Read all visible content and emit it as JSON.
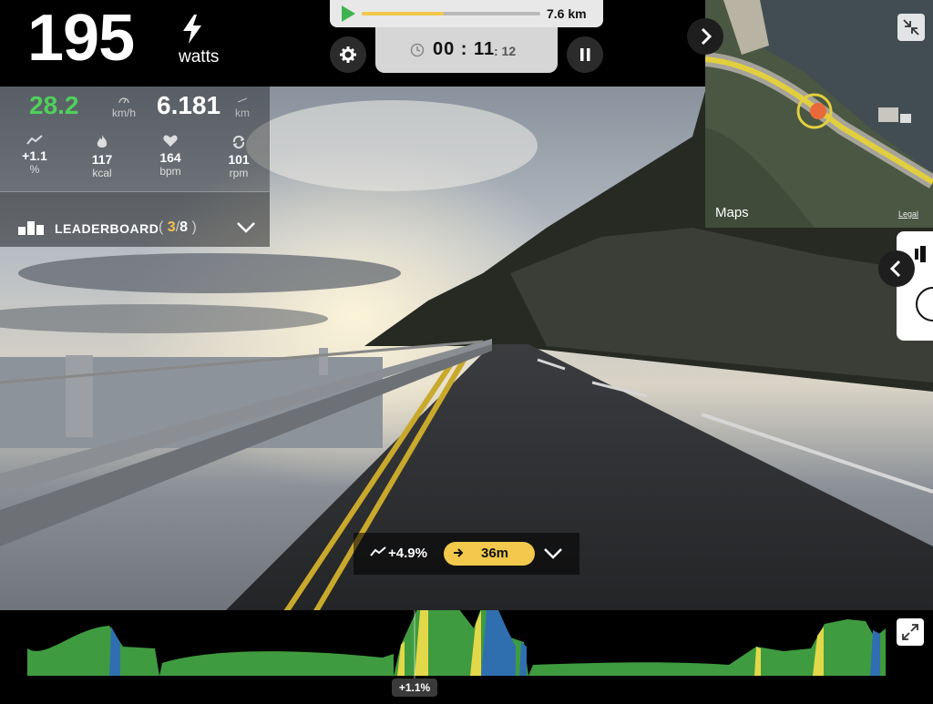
{
  "power": {
    "value": "195",
    "unit": "watts"
  },
  "speed": {
    "value": "28.2",
    "unit": "km/h"
  },
  "distance": {
    "value": "6.181",
    "unit": "km"
  },
  "stats": [
    {
      "value": "+1.1",
      "unit": "%",
      "icon": "gradient-icon"
    },
    {
      "value": "117",
      "unit": "kcal",
      "icon": "flame-icon"
    },
    {
      "value": "164",
      "unit": "bpm",
      "icon": "heart-icon"
    },
    {
      "value": "101",
      "unit": "rpm",
      "icon": "cadence-icon"
    }
  ],
  "leaderboard": {
    "label": "LEADERBOARD",
    "position": "3",
    "total": "8"
  },
  "progress": {
    "distance": "7.6 km",
    "fraction": 0.46
  },
  "timer": {
    "main": "00 : 11",
    "seconds": ": 12"
  },
  "map": {
    "brand": "Maps",
    "legal": "Legal"
  },
  "grade": {
    "value": "+4.9%",
    "next_distance": "36m"
  },
  "profile": {
    "cursor_label": "+1.1%"
  },
  "colors": {
    "accent": "#f2c94c",
    "speed": "#4fd15b",
    "profile_green": "#3f9b3f",
    "profile_yellow": "#e3d84a",
    "profile_blue": "#2f6fb0"
  }
}
